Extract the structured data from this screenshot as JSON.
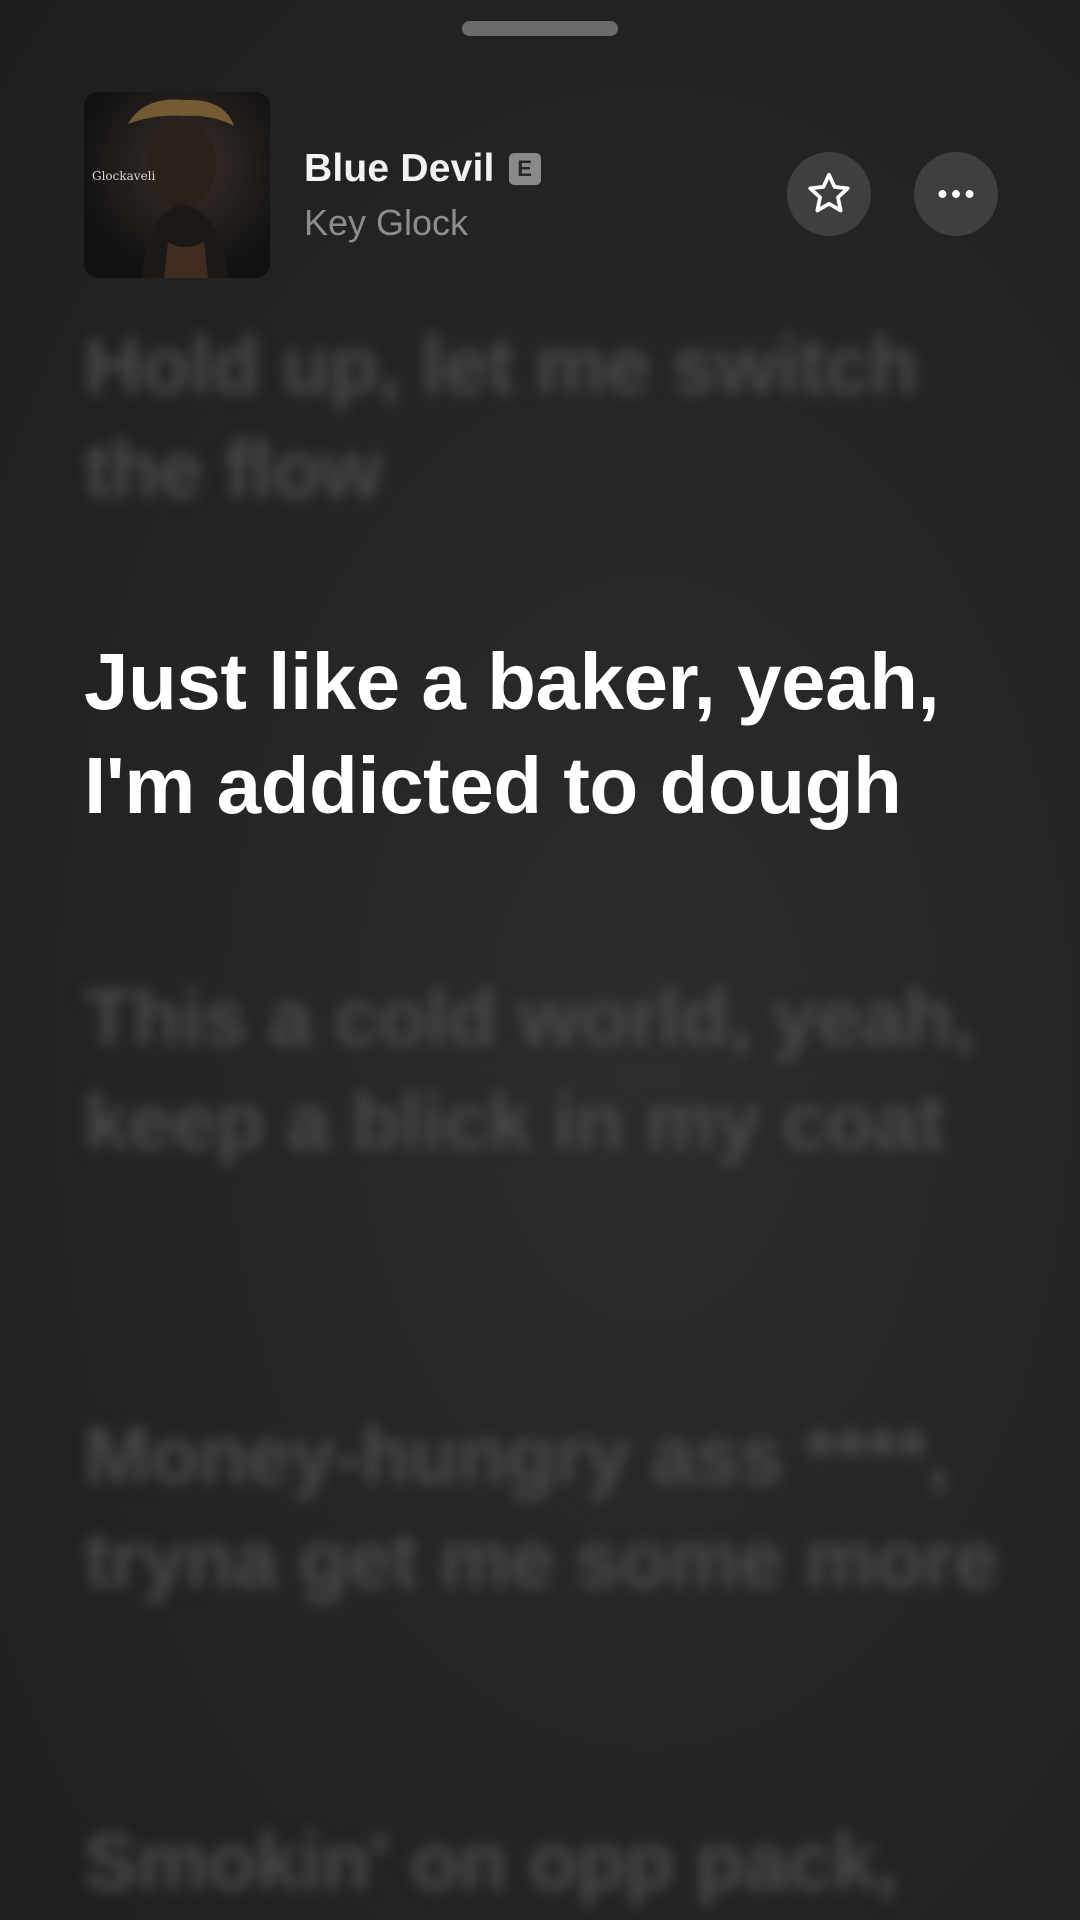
{
  "now_playing": {
    "title": "Blue Devil",
    "explicit_badge": "E",
    "artist": "Key Glock",
    "artwork_text": "Glockaveli",
    "favorite_icon": "star-icon",
    "more_icon": "ellipsis-icon"
  },
  "lyrics": {
    "previous": "Hold up, let me switch the flow",
    "current": "Just like a baker, yeah, I'm addicted to dough",
    "next_1": "This a cold world, yeah, keep a blick in my coat",
    "next_2": "Money-hungry ass ****, tryna get me some more",
    "next_3": "Smokin' on opp pack,"
  },
  "colors": {
    "background": "#232323",
    "active_lyric": "#ffffff",
    "inactive_lyric": "#4a4a4a",
    "artist_text": "#8d8d8d",
    "button_bg": "#3f3f3f"
  }
}
